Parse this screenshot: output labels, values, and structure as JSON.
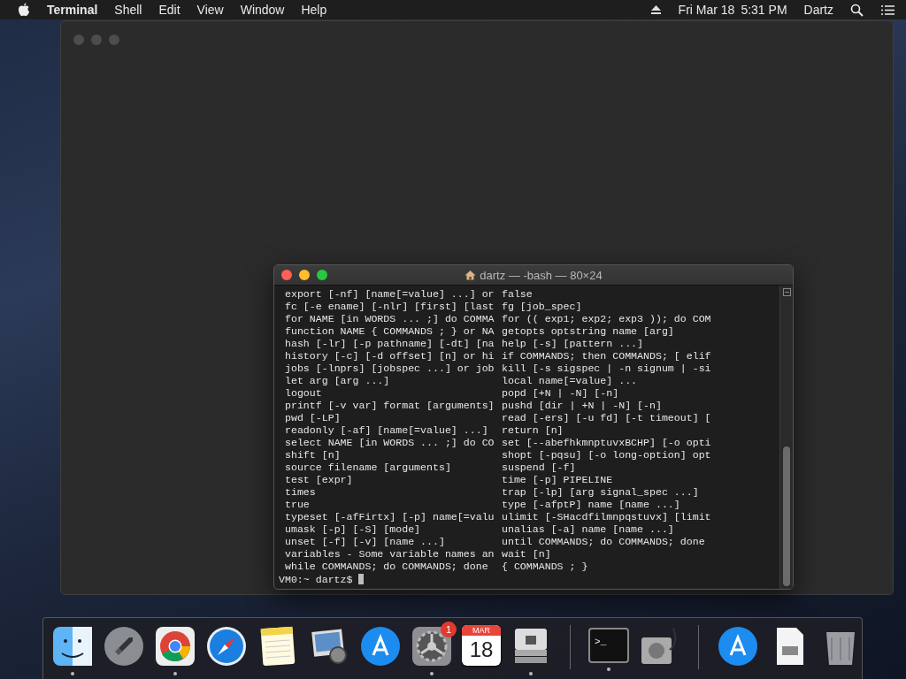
{
  "menu_bar": {
    "app_name": "Terminal",
    "menus": [
      "Shell",
      "Edit",
      "View",
      "Window",
      "Help"
    ],
    "date": "Fri Mar 18",
    "time": "5:31 PM",
    "user": "Dartz"
  },
  "background_window": {
    "focused": false
  },
  "terminal": {
    "title": "dartz — -bash — 80×24",
    "lines": [
      {
        "left": "export [-nf] [name[=value] ...] or",
        "right": "false"
      },
      {
        "left": "fc [-e ename] [-nlr] [first] [last",
        "right": "fg [job_spec]"
      },
      {
        "left": "for NAME [in WORDS ... ;] do COMMA",
        "right": "for (( exp1; exp2; exp3 )); do COM"
      },
      {
        "left": "function NAME { COMMANDS ; } or NA",
        "right": "getopts optstring name [arg]"
      },
      {
        "left": "hash [-lr] [-p pathname] [-dt] [na",
        "right": "help [-s] [pattern ...]"
      },
      {
        "left": "history [-c] [-d offset] [n] or hi",
        "right": "if COMMANDS; then COMMANDS; [ elif"
      },
      {
        "left": "jobs [-lnprs] [jobspec ...] or job",
        "right": "kill [-s sigspec | -n signum | -si"
      },
      {
        "left": "let arg [arg ...]",
        "right": "local name[=value] ..."
      },
      {
        "left": "logout",
        "right": "popd [+N | -N] [-n]"
      },
      {
        "left": "printf [-v var] format [arguments]",
        "right": "pushd [dir | +N | -N] [-n]"
      },
      {
        "left": "pwd [-LP]",
        "right": "read [-ers] [-u fd] [-t timeout] ["
      },
      {
        "left": "readonly [-af] [name[=value] ...]",
        "right": "return [n]"
      },
      {
        "left": "select NAME [in WORDS ... ;] do CO",
        "right": "set [--abefhkmnptuvxBCHP] [-o opti"
      },
      {
        "left": "shift [n]",
        "right": "shopt [-pqsu] [-o long-option] opt"
      },
      {
        "left": "source filename [arguments]",
        "right": "suspend [-f]"
      },
      {
        "left": "test [expr]",
        "right": "time [-p] PIPELINE"
      },
      {
        "left": "times",
        "right": "trap [-lp] [arg signal_spec ...]"
      },
      {
        "left": "true",
        "right": "type [-afptP] name [name ...]"
      },
      {
        "left": "typeset [-afFirtx] [-p] name[=valu",
        "right": "ulimit [-SHacdfilmnpqstuvx] [limit"
      },
      {
        "left": "umask [-p] [-S] [mode]",
        "right": "unalias [-a] name [name ...]"
      },
      {
        "left": "unset [-f] [-v] [name ...]",
        "right": "until COMMANDS; do COMMANDS; done"
      },
      {
        "left": "variables - Some variable names an",
        "right": "wait [n]"
      },
      {
        "left": "while COMMANDS; do COMMANDS; done",
        "right": "{ COMMANDS ; }"
      }
    ],
    "prompt": "VM0:~ dartz$"
  },
  "dock": {
    "items": [
      {
        "kind": "finder",
        "running": true
      },
      {
        "kind": "launchpad",
        "running": false
      },
      {
        "kind": "chrome",
        "running": true
      },
      {
        "kind": "safari",
        "running": false
      },
      {
        "kind": "notes",
        "running": false
      },
      {
        "kind": "preview",
        "running": false
      },
      {
        "kind": "appstore",
        "running": false
      },
      {
        "kind": "settings",
        "running": true,
        "badge": "1"
      },
      {
        "kind": "calendar",
        "running": false,
        "month": "MAR",
        "day": "18"
      },
      {
        "kind": "bootcamp",
        "running": true
      },
      {
        "kind": "separator"
      },
      {
        "kind": "terminal",
        "running": true,
        "glyph": ">_"
      },
      {
        "kind": "diskutility",
        "running": false
      },
      {
        "kind": "separator"
      },
      {
        "kind": "downloads",
        "running": false
      },
      {
        "kind": "document",
        "running": false
      },
      {
        "kind": "trash",
        "running": false
      }
    ]
  }
}
